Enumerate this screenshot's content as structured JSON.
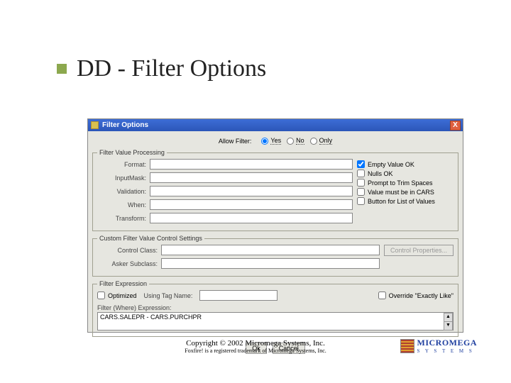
{
  "slide": {
    "title": "DD - Filter Options"
  },
  "dialog": {
    "title": "Filter Options",
    "close": "X",
    "allow_filter": {
      "label": "Allow Filter:",
      "options": [
        "Yes",
        "No",
        "Only"
      ]
    },
    "group1": {
      "legend": "Filter Value Processing",
      "fields": {
        "format": "Format:",
        "inputmask": "InputMask:",
        "validation": "Validation:",
        "when": "When:",
        "transform": "Transform:"
      },
      "checks": {
        "empty": "Empty Value OK",
        "nulls": "Nulls OK",
        "trim": "Prompt to Trim Spaces",
        "cars": "Value must be in CARS",
        "button_lov": "Button for List of Values"
      }
    },
    "group2": {
      "legend": "Custom Filter Value Control Settings",
      "control_class": "Control Class:",
      "asker_subclass": "Asker Subclass:",
      "props_btn": "Control Properties..."
    },
    "group3": {
      "legend": "Filter Expression",
      "optimize": "Optimized",
      "using_tag": "Using Tag Name:",
      "override": "Override \"Exactly Like\"",
      "where_label": "Filter (Where) Expression:",
      "where_value": "CARS.SALEPR - CARS.PURCHPR"
    },
    "buttons": {
      "ok": "Ok",
      "cancel": "Cancel"
    }
  },
  "footer": {
    "copyright": "Copyright © 2002 Micromega Systems, Inc.",
    "trademark": "Foxfire! is a registered trademark of Micromega Systems, Inc.",
    "logo_main": "MICROMEGA",
    "logo_sub": "S Y S T E M S"
  }
}
